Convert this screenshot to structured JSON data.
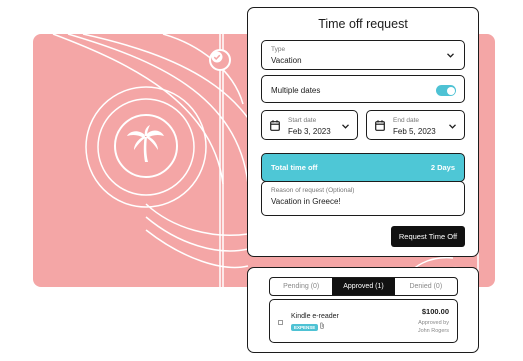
{
  "form": {
    "title": "Time off request",
    "type_label": "Type",
    "type_value": "Vacation",
    "multiple_dates_label": "Multiple dates",
    "multiple_dates_on": true,
    "start_label": "Start date",
    "start_value": "Feb 3, 2023",
    "end_label": "End date",
    "end_value": "Feb 5, 2023",
    "total_label": "Total time off",
    "total_value": "2 Days",
    "reason_label": "Reason of request (Optional)",
    "reason_value": "Vacation in Greece!",
    "submit_label": "Request Time Off"
  },
  "requests": {
    "tabs": [
      {
        "label": "Pending (0)"
      },
      {
        "label": "Approved (1)"
      },
      {
        "label": "Denied (0)"
      }
    ],
    "active_tab": "Approved (1)",
    "items": [
      {
        "name": "Kindle e-reader",
        "badge": "EXPENSE",
        "amount": "$100.00",
        "approved_by_label": "Approved by",
        "approver": "John Rogers"
      }
    ]
  },
  "colors": {
    "accent": "#4ec7d6",
    "background_card": "#f4a6a6",
    "dark": "#111111"
  },
  "icons": [
    "check-circle-icon",
    "palm-tree-icon",
    "chevron-down-icon",
    "calendar-icon",
    "paperclip-icon"
  ]
}
